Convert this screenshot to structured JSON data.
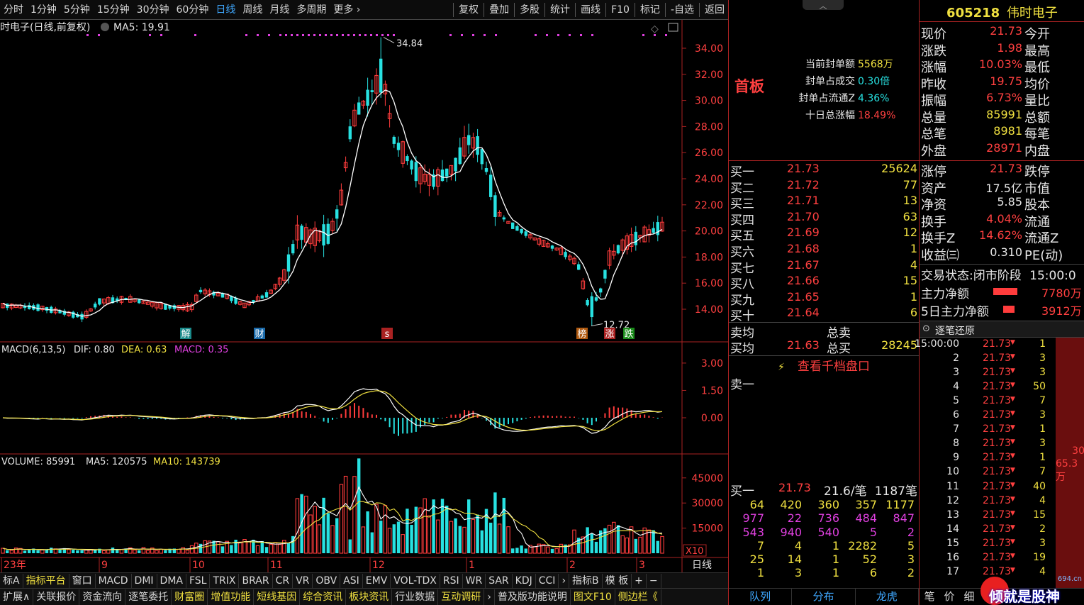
{
  "toolbar": {
    "items": [
      "分时",
      "1分钟",
      "5分钟",
      "15分钟",
      "30分钟",
      "60分钟",
      "日线",
      "周线",
      "月线",
      "多周期",
      "更多 ›"
    ],
    "active_index": 6,
    "right_items": [
      "复权",
      "叠加",
      "多股",
      "统计",
      "画线",
      "F10",
      "标记",
      "-自选",
      "返回"
    ]
  },
  "chart_header": {
    "title": "时电子(日线,前复权)",
    "ma_label": "MA5: 19.91"
  },
  "price_axis": [
    "34.00",
    "32.00",
    "30.00",
    "28.00",
    "26.00",
    "24.00",
    "22.00",
    "20.00",
    "18.00",
    "16.00",
    "14.00"
  ],
  "annotations": {
    "high": "34.84",
    "low": "12.72"
  },
  "event_markers": [
    "解",
    "财",
    "s",
    "榜",
    "涨",
    "跌"
  ],
  "macd_header": {
    "name": "MACD(6,13,5)",
    "dif": "DIF: 0.80",
    "dea": "DEA: 0.63",
    "macd": "MACD: 0.35"
  },
  "macd_axis": [
    "3.00",
    "1.50",
    "0.00"
  ],
  "volume_header": {
    "name": "VOLUME: 85991",
    "ma5": "MA5: 120575",
    "ma10": "MA10: 143739"
  },
  "volume_axis": [
    "45000",
    "30000",
    "15000"
  ],
  "volume_unit": "X10",
  "date_axis": [
    "23年",
    "9",
    "10",
    "11",
    "12",
    "1",
    "2",
    "3"
  ],
  "date_mode": "日线",
  "bottom_bar1": [
    "标A",
    "指标平台",
    "窗口",
    "MACD",
    "DMI",
    "DMA",
    "FSL",
    "TRIX",
    "BRAR",
    "CR",
    "VR",
    "OBV",
    "ASI",
    "EMV",
    "VOL-TDX",
    "RSI",
    "WR",
    "SAR",
    "KDJ",
    "CCI",
    "›",
    "指标B",
    "模 板",
    "+",
    "−"
  ],
  "bottom_bar2": [
    "扩展∧",
    "关联报价",
    "资金流向",
    "逐笔委托",
    "财富圈",
    "增值功能",
    "短线基因",
    "综合资讯",
    "板块资讯",
    "行业数据",
    "互动调研",
    "›",
    "普及版功能说明",
    "图文F10",
    "侧边栏《"
  ],
  "board_label": "首板",
  "seal_info": [
    {
      "label": "当前封单额",
      "value": "5568万"
    },
    {
      "label": "封单占成交",
      "value": "0.30倍"
    },
    {
      "label": "封单占流通Z",
      "value": "4.36%"
    },
    {
      "label": "十日总涨幅",
      "value": "18.49%"
    }
  ],
  "bids": [
    {
      "label": "买一",
      "price": "21.73",
      "vol": "25624"
    },
    {
      "label": "买二",
      "price": "21.72",
      "vol": "77"
    },
    {
      "label": "买三",
      "price": "21.71",
      "vol": "13"
    },
    {
      "label": "买四",
      "price": "21.70",
      "vol": "63"
    },
    {
      "label": "买五",
      "price": "21.69",
      "vol": "12"
    },
    {
      "label": "买六",
      "price": "21.68",
      "vol": "1"
    },
    {
      "label": "买七",
      "price": "21.67",
      "vol": "4"
    },
    {
      "label": "买八",
      "price": "21.66",
      "vol": "15"
    },
    {
      "label": "买九",
      "price": "21.65",
      "vol": "1"
    },
    {
      "label": "买十",
      "price": "21.64",
      "vol": "6"
    }
  ],
  "avg": {
    "sell_label": "卖均",
    "buy_label": "买均",
    "buy_price": "21.63",
    "total_sell": "总卖",
    "total_buy": "总买",
    "total_buy_val": "28245"
  },
  "thousand_link": "查看千档盘口",
  "sell1_label": "卖一",
  "queue": {
    "label": "买一",
    "price": "21.73",
    "avg": "21.6/笔",
    "count": "1187笔",
    "rows": [
      [
        "64",
        "420",
        "360",
        "357",
        "1177"
      ],
      [
        "977",
        "22",
        "736",
        "484",
        "847"
      ],
      [
        "543",
        "940",
        "540",
        "5",
        "2"
      ],
      [
        "7",
        "4",
        "1",
        "2282",
        "5"
      ],
      [
        "25",
        "14",
        "1",
        "52",
        "3"
      ],
      [
        "1",
        "3",
        "1",
        "6",
        "2"
      ]
    ]
  },
  "right_tabs": [
    "队列",
    "分布",
    "龙虎"
  ],
  "stock": {
    "code": "605218",
    "name": "伟时电子"
  },
  "quote": [
    {
      "l": "现价",
      "v": "21.73",
      "r": "今开"
    },
    {
      "l": "涨跌",
      "v": "1.98",
      "r": "最高"
    },
    {
      "l": "涨幅",
      "v": "10.03%",
      "r": "最低"
    },
    {
      "l": "昨收",
      "v": "19.75",
      "r": "均价"
    },
    {
      "l": "振幅",
      "v": "6.73%",
      "r": "量比"
    },
    {
      "l": "总量",
      "v": "85991",
      "r": "总额"
    },
    {
      "l": "总笔",
      "v": "8981",
      "r": "每笔"
    },
    {
      "l": "外盘",
      "v": "28971",
      "r": "内盘"
    }
  ],
  "quote2": [
    {
      "l": "涨停",
      "v": "21.73",
      "r": "跌停"
    },
    {
      "l": "资产",
      "v": "17.5亿",
      "r": "市值"
    },
    {
      "l": "净资",
      "v": "5.85",
      "r": "股本"
    },
    {
      "l": "换手",
      "v": "4.04%",
      "r": "流通"
    },
    {
      "l": "换手Z",
      "v": "14.62%",
      "r": "流通Z"
    },
    {
      "l": "收益㈢",
      "v": "0.310",
      "r": "PE(动)"
    }
  ],
  "trade_state": {
    "label": "交易状态:",
    "value": "闭市阶段",
    "time": "15:00:0"
  },
  "main_flow": [
    {
      "label": "主力净额",
      "value": "7780万"
    },
    {
      "label": "5日主力净额",
      "value": "3912万"
    }
  ],
  "tick_header": "逐笔还原",
  "ticks": [
    {
      "t": "15:00:00",
      "p": "21.73",
      "v": "1"
    },
    {
      "t": "2",
      "p": "21.73",
      "v": "3"
    },
    {
      "t": "3",
      "p": "21.73",
      "v": "3"
    },
    {
      "t": "4",
      "p": "21.73",
      "v": "50"
    },
    {
      "t": "5",
      "p": "21.73",
      "v": "7"
    },
    {
      "t": "6",
      "p": "21.73",
      "v": "3"
    },
    {
      "t": "7",
      "p": "21.73",
      "v": "1"
    },
    {
      "t": "8",
      "p": "21.73",
      "v": "3"
    },
    {
      "t": "9",
      "p": "21.73",
      "v": "1"
    },
    {
      "t": "10",
      "p": "21.73",
      "v": "7"
    },
    {
      "t": "11",
      "p": "21.73",
      "v": "40"
    },
    {
      "t": "12",
      "p": "21.73",
      "v": "4"
    },
    {
      "t": "13",
      "p": "21.73",
      "v": "15"
    },
    {
      "t": "14",
      "p": "21.73",
      "v": "2"
    },
    {
      "t": "15",
      "p": "21.73",
      "v": "3"
    },
    {
      "t": "16",
      "p": "21.73",
      "v": "19"
    },
    {
      "t": "17",
      "p": "21.73",
      "v": "4"
    }
  ],
  "side_big": {
    "a": "30",
    "b": "65.3万"
  },
  "right_bottom_tabs": [
    "笔",
    "价",
    "细"
  ],
  "watermark": "倾就是股神",
  "watermark_site": "694.cn",
  "colors": {
    "up": "#ff3c3c",
    "down": "#27e1e1",
    "ma5": "#ffffff",
    "dea": "#f0e040",
    "macd_name": "#e040e0"
  }
}
